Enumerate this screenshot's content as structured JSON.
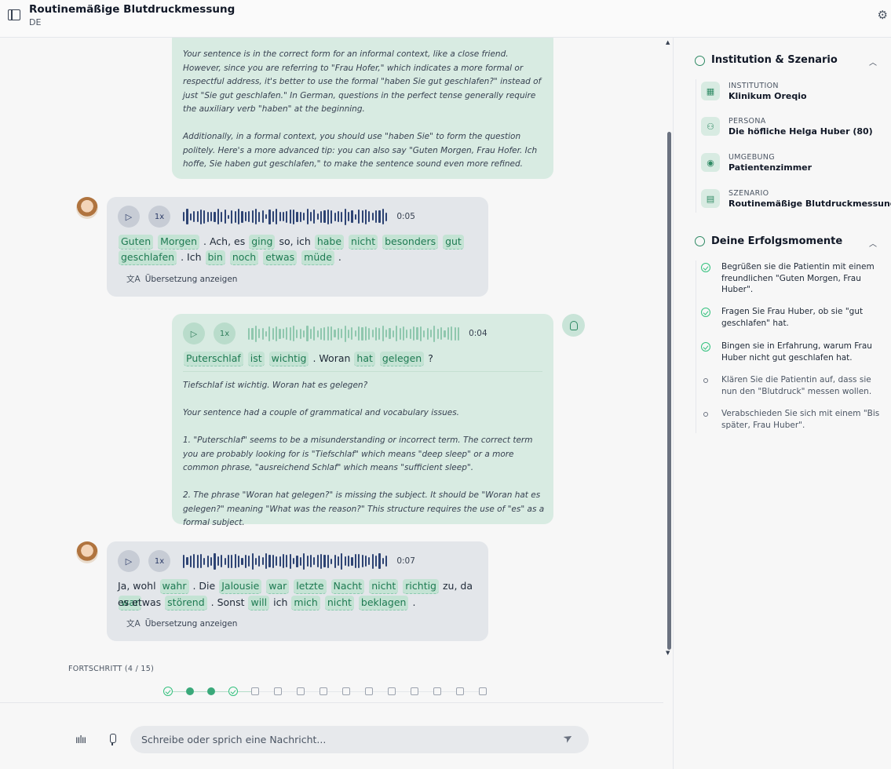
{
  "header": {
    "title": "Routinemäßige Blutdruckmessung",
    "language": "DE"
  },
  "feedback_top": {
    "paragraphs": [
      "Your sentence is in the correct form for an informal context, like a close friend. However, since you are referring to \"Frau Hofer,\" which indicates a more formal or respectful address, it's better to use the formal \"haben Sie gut geschlafen?\" instead of just \"Sie gut geschlafen.\" In German, questions in the perfect tense generally require the auxiliary verb \"haben\" at the beginning.",
      "Additionally, in a formal context, you should use \"haben Sie\" to form the question politely. Here's a more advanced tip: you can also say \"Guten Morgen, Frau Hofer. Ich hoffe, Sie haben gut geschlafen,\" to make the sentence sound even more refined."
    ]
  },
  "messages": [
    {
      "role": "patient",
      "speed": "1x",
      "duration": "0:05",
      "line1": [
        [
          "Guten",
          true
        ],
        [
          "Morgen",
          true
        ],
        [
          ". Ach, es",
          false
        ],
        [
          "ging",
          true
        ],
        [
          "so, ich",
          false
        ],
        [
          "habe",
          true
        ],
        [
          "nicht",
          true
        ],
        [
          "besonders",
          true
        ],
        [
          "gut",
          true
        ]
      ],
      "line2": [
        [
          "geschlafen",
          true
        ],
        [
          ". Ich",
          false
        ],
        [
          "bin",
          true
        ],
        [
          "noch",
          true
        ],
        [
          "etwas",
          true
        ],
        [
          "müde",
          true
        ],
        [
          ".",
          false
        ]
      ],
      "translate_label": "Übersetzung anzeigen"
    },
    {
      "role": "user",
      "speed": "1x",
      "duration": "0:04",
      "line1": [
        [
          "Puterschlaf",
          true
        ],
        [
          "ist",
          true
        ],
        [
          "wichtig",
          true
        ],
        [
          ". Woran",
          false
        ],
        [
          "hat",
          true
        ],
        [
          "gelegen",
          true
        ],
        [
          "?",
          false
        ]
      ],
      "feedback": [
        "Tiefschlaf ist wichtig. Woran hat es gelegen?",
        "Your sentence had a couple of grammatical and vocabulary issues.",
        "1. \"Puterschlaf\" seems to be a misunderstanding or incorrect term. The correct term you are probably looking for is \"Tiefschlaf\" which means \"deep sleep\" or a more common phrase, \"ausreichend Schlaf\" which means \"sufficient sleep\".",
        "2. The phrase \"Woran hat gelegen?\" is missing the subject. It should be \"Woran hat es gelegen?\" meaning \"What was the reason?\" This structure requires the use of \"es\" as a formal subject."
      ]
    },
    {
      "role": "patient",
      "speed": "1x",
      "duration": "0:07",
      "line1": [
        [
          "Ja, wohl",
          false
        ],
        [
          "wahr",
          true
        ],
        [
          ". Die",
          false
        ],
        [
          "Jalousie",
          true
        ],
        [
          "war",
          true
        ],
        [
          "letzte",
          true
        ],
        [
          "Nacht",
          true
        ],
        [
          "nicht",
          true
        ],
        [
          "richtig",
          true
        ],
        [
          "zu, da",
          false
        ],
        [
          "war",
          true
        ]
      ],
      "line2": [
        [
          "es etwas",
          false
        ],
        [
          "störend",
          true
        ],
        [
          ". Sonst",
          false
        ],
        [
          "will",
          true
        ],
        [
          "ich",
          false
        ],
        [
          "mich",
          true
        ],
        [
          "nicht",
          true
        ],
        [
          "beklagen",
          true
        ],
        [
          ".",
          false
        ]
      ],
      "translate_label": "Übersetzung anzeigen"
    }
  ],
  "progress": {
    "label": "FORTSCHRITT (4 / 15)",
    "steps": [
      "done",
      "dot",
      "dot",
      "done",
      "todo",
      "todo",
      "todo",
      "todo",
      "todo",
      "todo",
      "todo",
      "todo",
      "todo",
      "todo",
      "todo"
    ]
  },
  "composer": {
    "placeholder": "Schreibe oder sprich eine Nachricht..."
  },
  "panel": {
    "institution_section": {
      "title": "Institution & Szenario",
      "items": [
        {
          "label": "INSTITUTION",
          "value": "Klinikum Oreqio",
          "icon": "building-icon"
        },
        {
          "label": "PERSONA",
          "value": "Die höfliche Helga Huber (80)",
          "icon": "person-icon"
        },
        {
          "label": "UMGEBUNG",
          "value": "Patientenzimmer",
          "icon": "location-pin-icon"
        },
        {
          "label": "SZENARIO",
          "value": "Routinemäßige Blutdruckmessung",
          "icon": "clapperboard-icon"
        }
      ]
    },
    "goals_section": {
      "title": "Deine Erfolgsmomente",
      "items": [
        {
          "text": "Begrüßen sie die Patientin mit einem freundlichen \"Guten Morgen, Frau Huber\".",
          "done": true
        },
        {
          "text": "Fragen Sie Frau Huber, ob sie \"gut geschlafen\" hat.",
          "done": true
        },
        {
          "text": "Bingen sie in Erfahrung, warum Frau Huber nicht gut geschlafen hat.",
          "done": true
        },
        {
          "text": "Klären Sie die Patientin auf, dass sie nun den \"Blutdruck\" messen wollen.",
          "done": false
        },
        {
          "text": "Verabschieden Sie sich mit einem \"Bis später, Frau Huber\".",
          "done": false
        }
      ]
    }
  },
  "colors": {
    "accent": "#2f8a64",
    "bubble_user": "#d8ebe2",
    "bubble_patient": "#e3e6ea",
    "wave_patient": "#2d4373",
    "wave_user": "#8fc7ae"
  }
}
